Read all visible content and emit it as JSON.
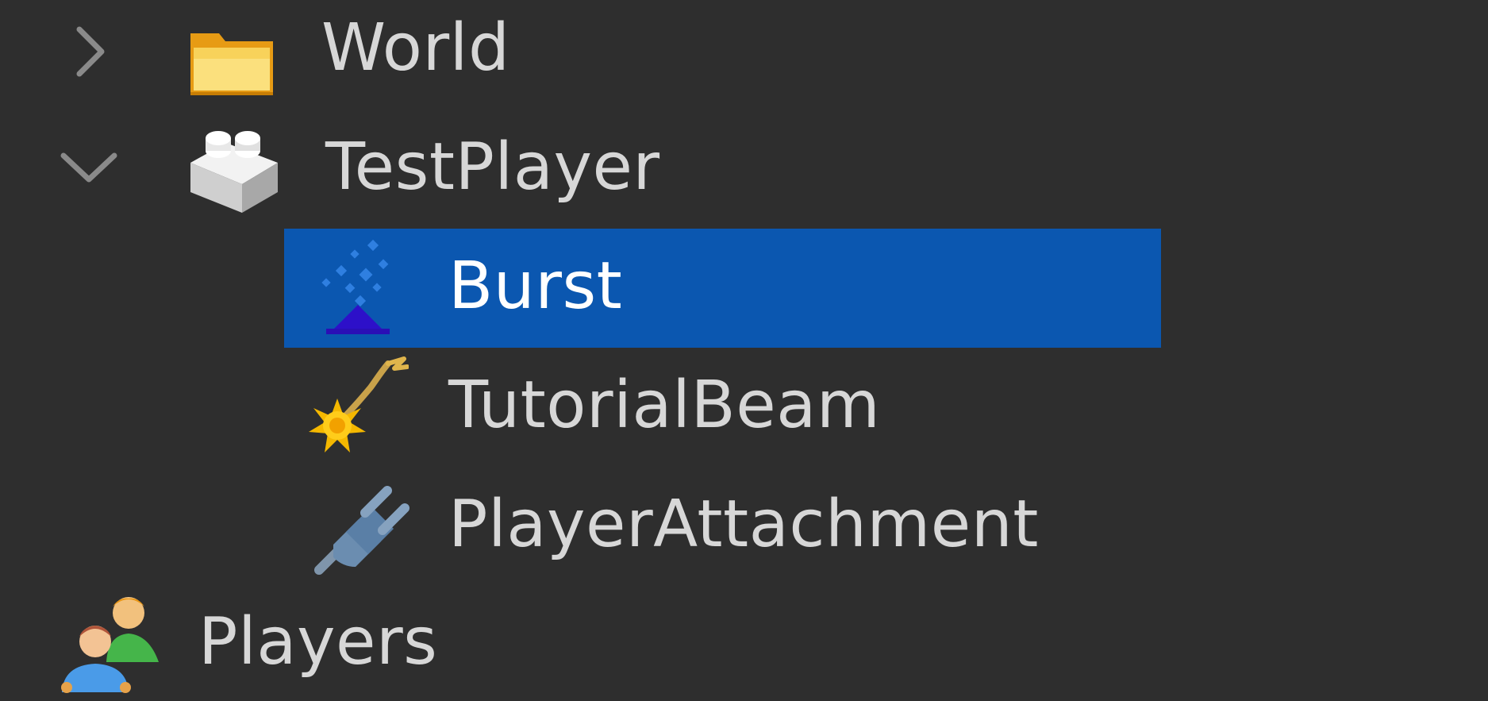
{
  "tree": {
    "items": [
      {
        "label": "World",
        "icon": "folder-icon",
        "expanded": false,
        "has_children": true,
        "depth": 1,
        "selected": false
      },
      {
        "label": "TestPlayer",
        "icon": "model-icon",
        "expanded": true,
        "has_children": true,
        "depth": 1,
        "selected": false
      },
      {
        "label": "Burst",
        "icon": "particle-emitter-icon",
        "expanded": false,
        "has_children": false,
        "depth": 2,
        "selected": true
      },
      {
        "label": "TutorialBeam",
        "icon": "beam-icon",
        "expanded": false,
        "has_children": false,
        "depth": 2,
        "selected": false
      },
      {
        "label": "PlayerAttachment",
        "icon": "attachment-plug-icon",
        "expanded": false,
        "has_children": false,
        "depth": 2,
        "selected": false
      },
      {
        "label": "Players",
        "icon": "players-icon",
        "expanded": false,
        "has_children": false,
        "depth": 0,
        "selected": false
      }
    ]
  },
  "colors": {
    "background": "#2e2e2e",
    "selection": "#0b57b0",
    "text": "#d7d7d7",
    "text_selected": "#ffffff"
  }
}
